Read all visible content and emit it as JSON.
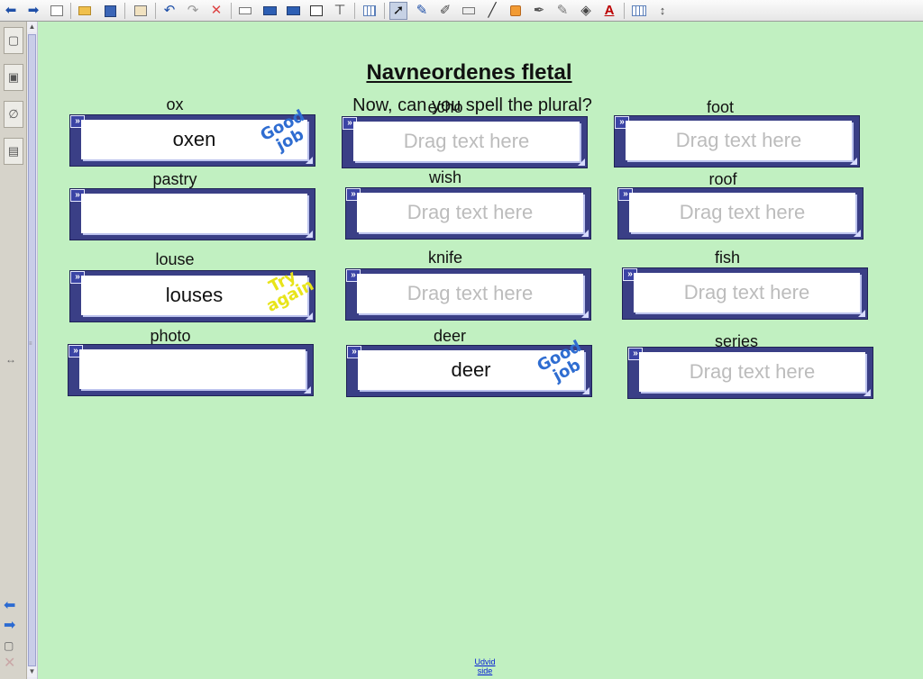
{
  "toolbar": {
    "icons": [
      "back-arrow-icon",
      "forward-arrow-icon",
      "new-page-icon",
      "open-folder-icon",
      "save-icon",
      "paste-icon",
      "undo-icon",
      "redo-icon",
      "delete-icon",
      "screen-shade-icon",
      "display-icon",
      "dual-display-icon",
      "capture-icon",
      "toolbar-icon",
      "table-icon",
      "select-cursor-icon",
      "pen-icon",
      "creative-pen-icon",
      "eraser-icon",
      "line-icon",
      "fill-icon",
      "magic-pen-icon",
      "highlighter-icon",
      "shape-icon",
      "text-icon",
      "font-props-icon",
      "resize-icon"
    ]
  },
  "sidebar": {
    "items": [
      "page-sorter",
      "gallery",
      "attachments",
      "properties"
    ],
    "resize_glyph": "↔"
  },
  "page": {
    "title": "Navneordenes fletal",
    "subtitle": "Now, can you spell the plural?",
    "placeholder": "Drag text here",
    "footer_link": "Udvid side"
  },
  "cells": [
    {
      "label": "ox",
      "answer": "oxen",
      "stamp": "Good job"
    },
    {
      "label": "echo",
      "answer": "",
      "stamp": ""
    },
    {
      "label": "foot",
      "answer": "",
      "stamp": ""
    },
    {
      "label": "pastry",
      "answer": "",
      "stamp": ""
    },
    {
      "label": "wish",
      "answer": "",
      "stamp": ""
    },
    {
      "label": "roof",
      "answer": "",
      "stamp": ""
    },
    {
      "label": "louse",
      "answer": "louses",
      "stamp": "Try again"
    },
    {
      "label": "knife",
      "answer": "",
      "stamp": ""
    },
    {
      "label": "fish",
      "answer": "",
      "stamp": ""
    },
    {
      "label": "photo",
      "answer": "",
      "stamp": ""
    },
    {
      "label": "deer",
      "answer": "deer",
      "stamp": "Good job"
    },
    {
      "label": "series",
      "answer": "",
      "stamp": ""
    }
  ],
  "colors": {
    "canvas": "#c1f0c1",
    "box": "#3a3f86",
    "good_stamp": "#2f6dd1",
    "try_stamp": "#e8e41a"
  }
}
